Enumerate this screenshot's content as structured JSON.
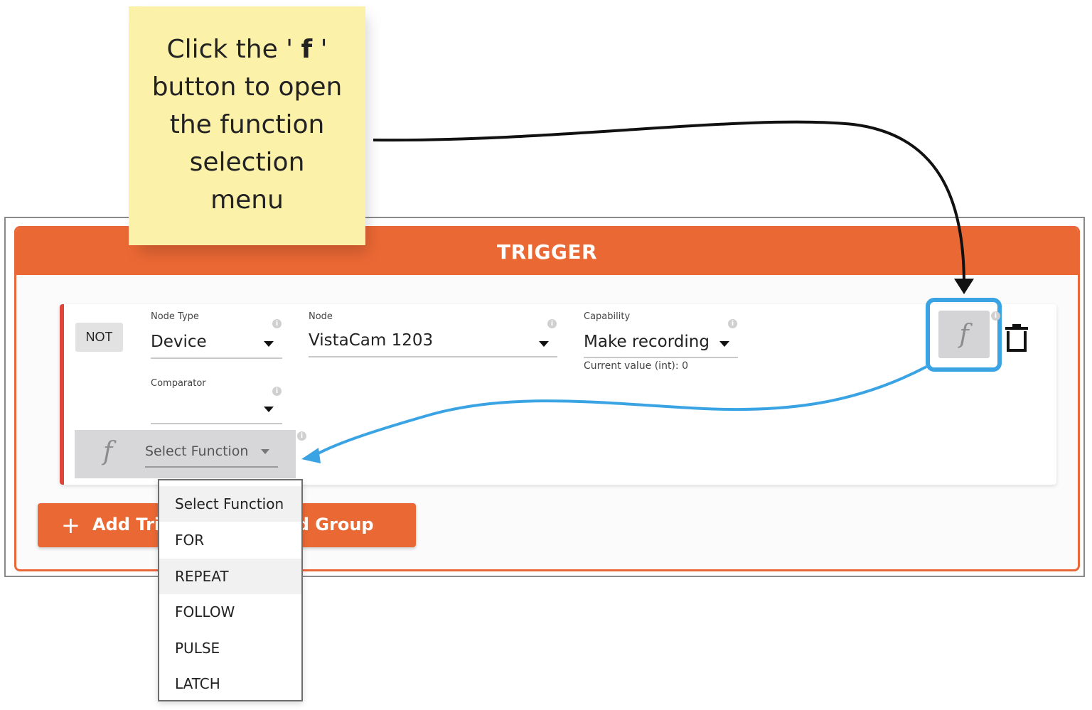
{
  "sticky_note": {
    "line1_prefix": "Click the ' ",
    "line1_bold": "f",
    "line1_suffix": " '",
    "line2": "button to open",
    "line3": "the function",
    "line4": "selection",
    "line5": "menu"
  },
  "trigger_panel": {
    "title": "TRIGGER"
  },
  "rule": {
    "not_label": "NOT",
    "node_type": {
      "label": "Node Type",
      "value": "Device"
    },
    "node": {
      "label": "Node",
      "value": "VistaCam 1203"
    },
    "capability": {
      "label": "Capability",
      "value": "Make recording",
      "helper": "Current value (int): 0"
    },
    "comparator": {
      "label": "Comparator",
      "value": ""
    },
    "function_button_glyph": "f",
    "function_select": {
      "glyph": "f",
      "label": "Select Function"
    }
  },
  "info_glyph": "i",
  "buttons": {
    "add_trigger_label": "Add Trigger",
    "add_group_label": "Add Group",
    "plus": "+"
  },
  "function_menu": {
    "items": [
      "Select Function",
      "FOR",
      "REPEAT",
      "FOLLOW",
      "PULSE",
      "LATCH"
    ]
  },
  "colors": {
    "accent_orange": "#ea6834",
    "rule_left_border": "#e0453a",
    "highlight_blue": "#3aa3e3",
    "sticky_yellow": "#fbf1a9"
  },
  "icons": {
    "trash": "trash-icon",
    "info": "info-icon",
    "function": "function-icon",
    "caret": "chevron-down-icon"
  }
}
